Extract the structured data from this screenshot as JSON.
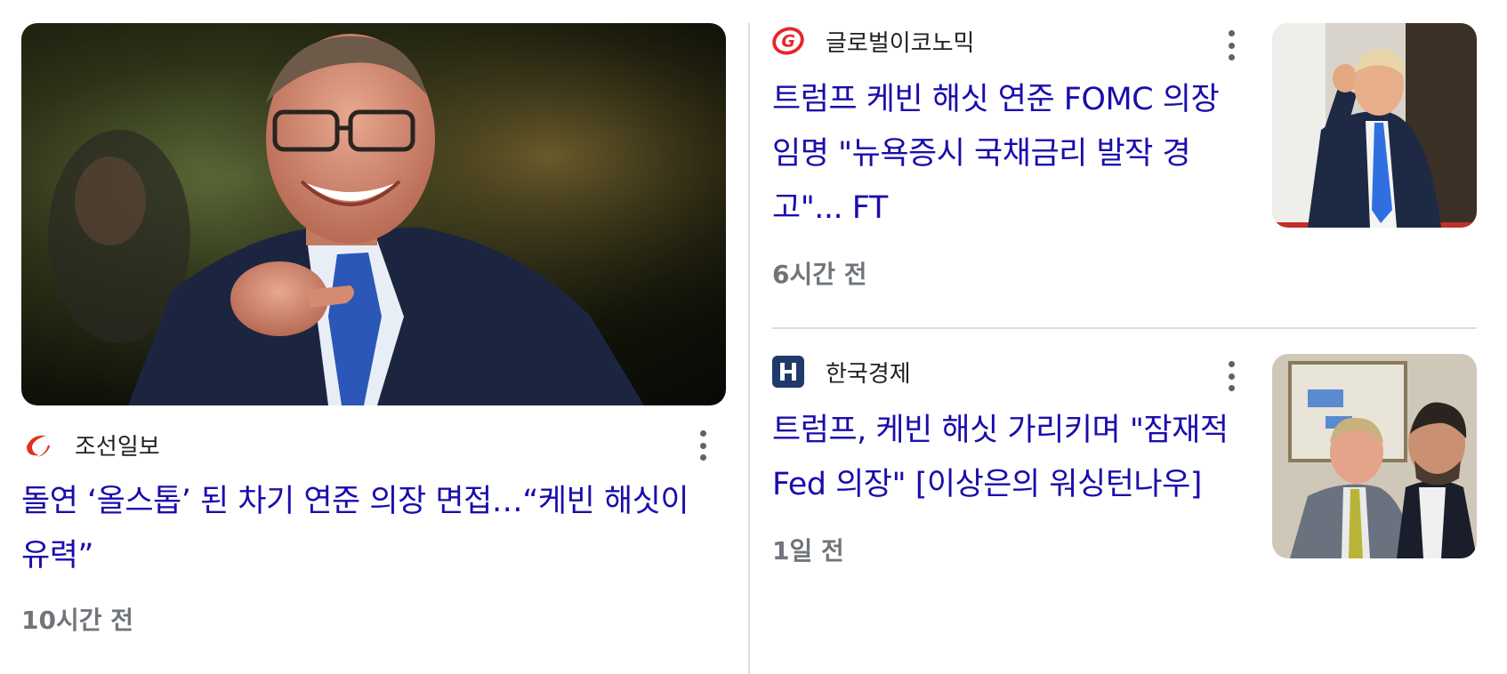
{
  "left_article": {
    "source": "조선일보",
    "headline": "돌연 ‘올스톱’ 된 차기 연준 의장 면접…“케빈 해싯이 유력”",
    "time": "10시간 전",
    "image_icon": "photo-man-pointing"
  },
  "right_articles": [
    {
      "source": "글로벌이코노믹",
      "headline": "트럼프 케빈 해싯 연준 FOMC 의장 임명 \"뉴욕증시 국채금리 발작 경고\"... FT",
      "time": "6시간 전",
      "logo_icon": "g-swirl-logo",
      "image_icon": "photo-trump-pointing"
    },
    {
      "source": "한국경제",
      "headline": "트럼프, 케빈 해싯 가리키며 \"잠재적 Fed 의장\" [이상은의 워싱턴나우]",
      "time": "1일 전",
      "logo_icon": "h-logo",
      "image_icon": "photo-two-men"
    }
  ],
  "colors": {
    "headline": "#1a0dab",
    "source_text": "#202124",
    "time_text": "#70757a",
    "divider": "#dadce0",
    "chosun_logo": "#e0301e",
    "global_logo": "#e8242b",
    "hankyung_logo": "#1f3a6b"
  }
}
